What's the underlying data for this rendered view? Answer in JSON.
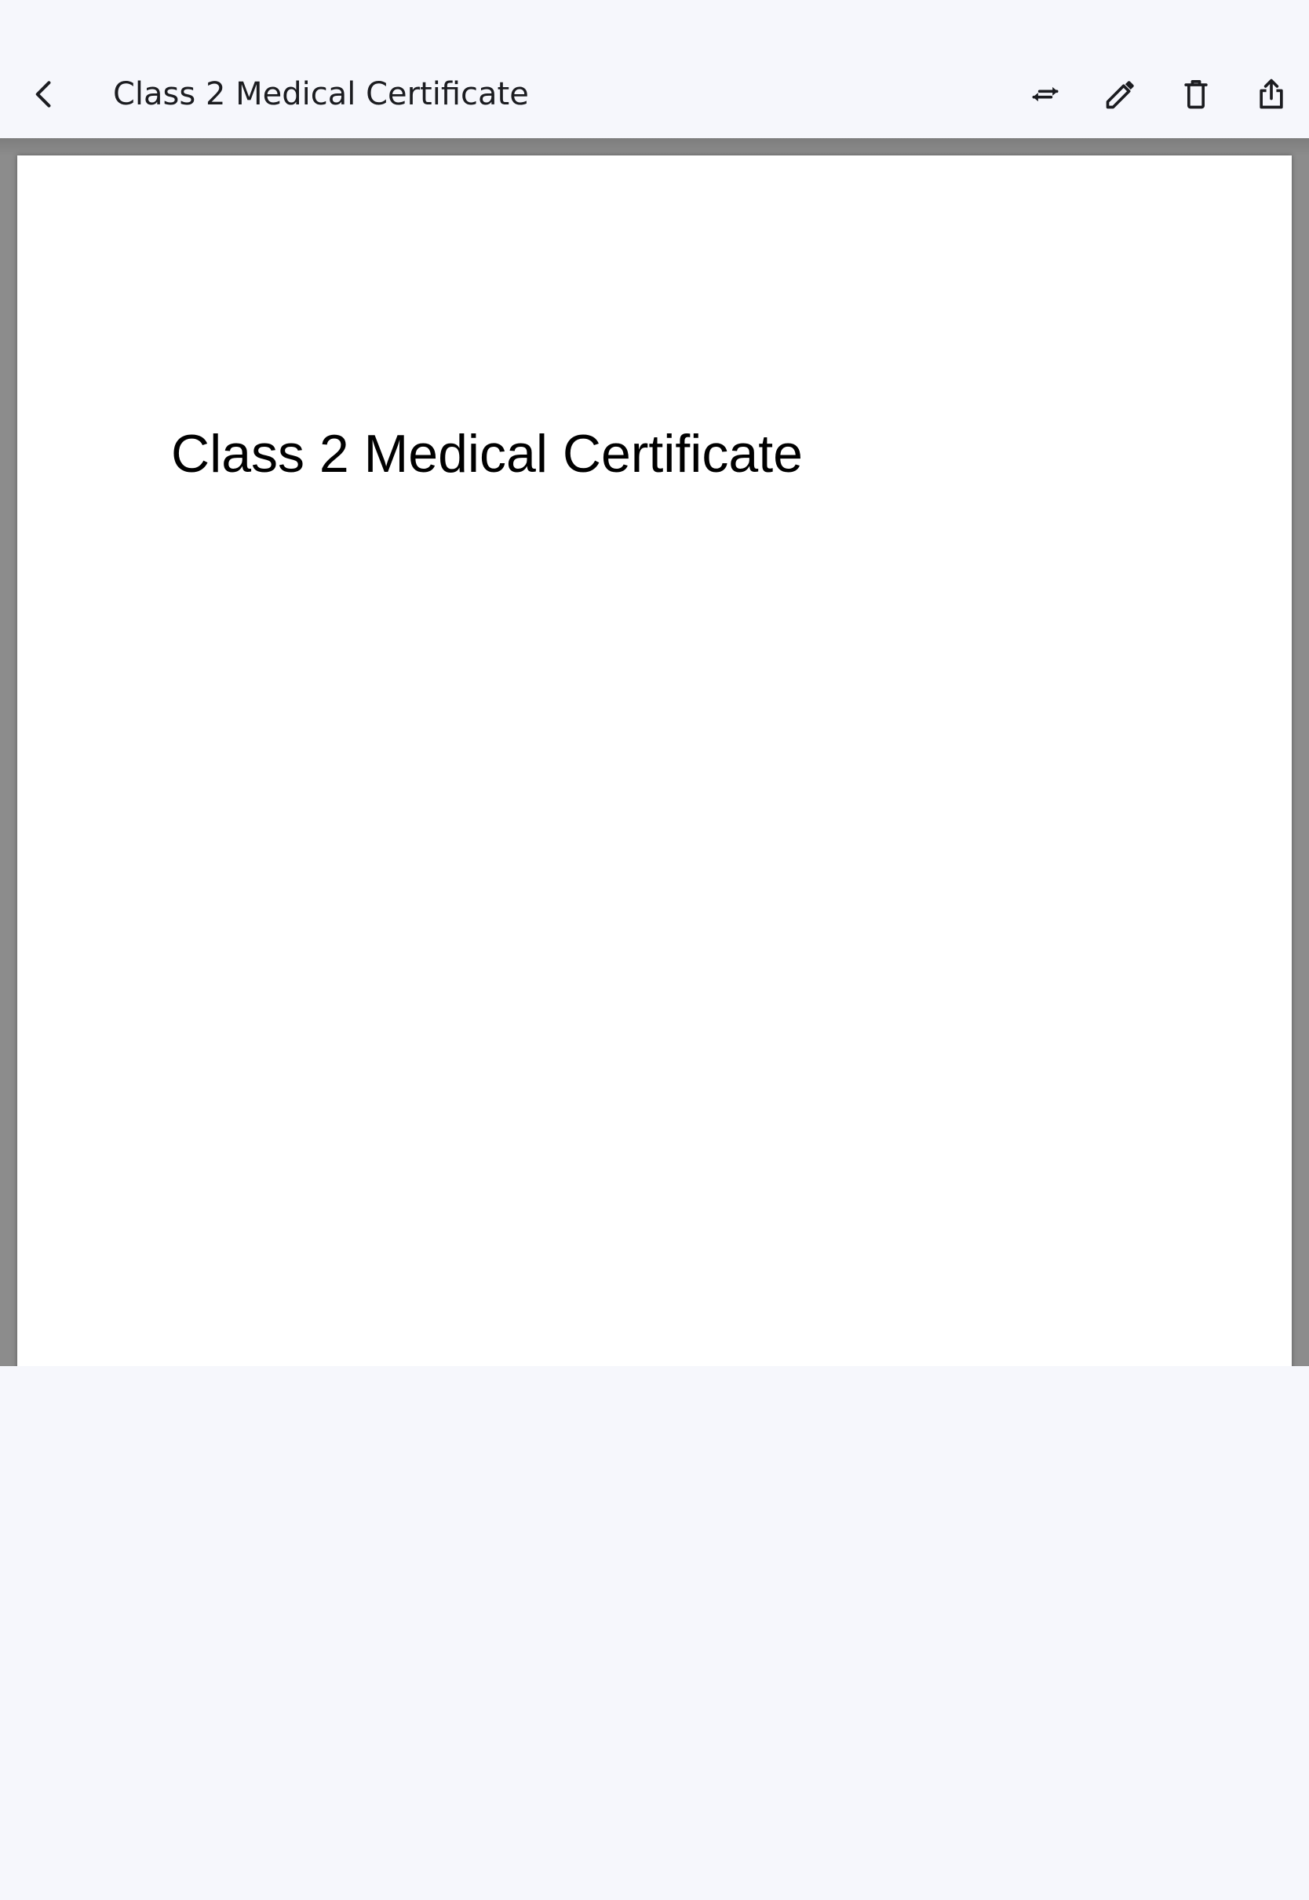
{
  "header": {
    "title": "Class 2 Medical Certificate",
    "icons": {
      "back": "chevron-left-icon",
      "swap": "swap-arrows-icon",
      "edit": "pencil-icon",
      "delete": "trash-icon",
      "share": "share-icon"
    }
  },
  "document": {
    "heading": "Class 2 Medical Certificate"
  },
  "colors": {
    "background": "#f6f7fc",
    "viewer_background": "#8c8c8c",
    "page": "#ffffff",
    "text": "#1b1c20"
  }
}
